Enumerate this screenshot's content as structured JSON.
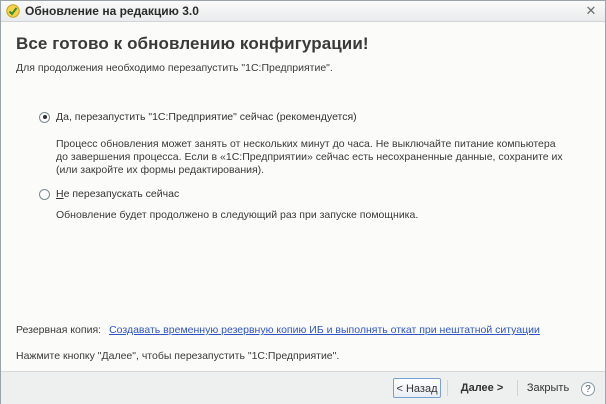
{
  "window": {
    "title": "Обновление на редакцию 3.0",
    "close_glyph": "✕"
  },
  "main": {
    "heading": "Все готово к обновлению конфигурации!",
    "subheading": "Для продолжения необходимо перезапустить \"1С:Предприятие\"."
  },
  "options": [
    {
      "label_accel": "Д",
      "label_rest": "а, перезапустить \"1С:Предприятие\" сейчас (рекомендуется)",
      "checked": true,
      "description_lines": [
        "Процесс обновления может занять от нескольких минут до часа. Не выключайте питание компьютера",
        "до завершения процесса. Если в «1С:Предприятии» сейчас есть несохраненные данные, сохраните их",
        "(или закройте их формы редактирования)."
      ]
    },
    {
      "label_accel": "Н",
      "label_rest": "е перезапускать сейчас",
      "checked": false,
      "description_lines": [
        "Обновление будет продолжено в следующий раз при запуске помощника."
      ]
    }
  ],
  "backup": {
    "label": "Резервная копия:",
    "link": "Создавать временную резервную копию ИБ и выполнять откат при нештатной ситуации"
  },
  "hint": "Нажмите кнопку \"Далее\", чтобы перезапустить \"1С:Предприятие\".",
  "footer": {
    "back_label": "< Назад",
    "next_label": "Далее >",
    "close_label": "Закрыть",
    "help_label": "?"
  }
}
